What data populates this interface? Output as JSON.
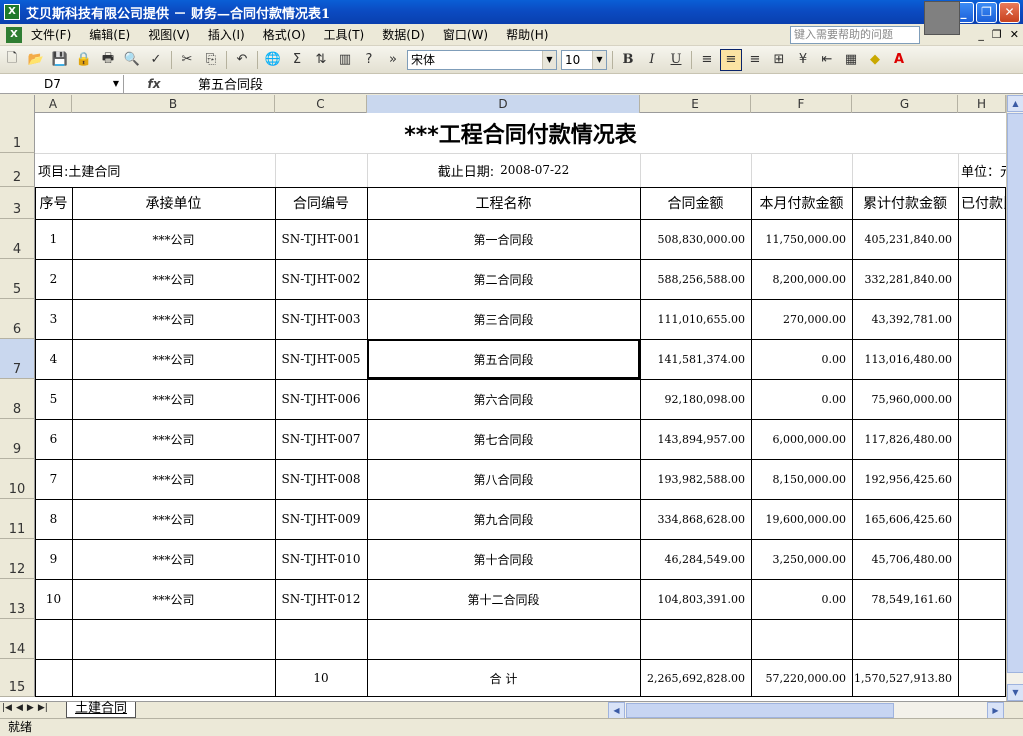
{
  "window": {
    "title": "艾贝斯科技有限公司提供 － 财务—合同付款情况表1"
  },
  "menu": [
    {
      "label": "文件(F)"
    },
    {
      "label": "编辑(E)"
    },
    {
      "label": "视图(V)"
    },
    {
      "label": "插入(I)"
    },
    {
      "label": "格式(O)"
    },
    {
      "label": "工具(T)"
    },
    {
      "label": "数据(D)"
    },
    {
      "label": "窗口(W)"
    },
    {
      "label": "帮助(H)"
    }
  ],
  "help_placeholder": "键入需要帮助的问题",
  "toolbar": {
    "font": "宋体",
    "font_size": "10"
  },
  "formula_bar": {
    "name_box": "D7",
    "value": "第五合同段"
  },
  "columns": [
    "A",
    "B",
    "C",
    "D",
    "E",
    "F",
    "G",
    "H"
  ],
  "rows": [
    "1",
    "2",
    "3",
    "4",
    "5",
    "6",
    "7",
    "8",
    "9",
    "10",
    "11",
    "12",
    "13",
    "14",
    "15"
  ],
  "sheet": {
    "title": "***工程合同付款情况表",
    "project": "项目:土建合同",
    "date_label": "截止日期:",
    "date_value": "2008-07-22",
    "unit": "单位：元",
    "headers": [
      "序号",
      "承接单位",
      "合同编号",
      "工程名称",
      "合同金额",
      "本月付款金额",
      "累计付款金额",
      "已付款比例"
    ],
    "records": [
      {
        "no": "1",
        "company": "***公司",
        "code": "SN-TJHT-001",
        "name": "第一合同段",
        "amount": "508,830,000.00",
        "month": "11,750,000.00",
        "total": "405,231,840.00"
      },
      {
        "no": "2",
        "company": "***公司",
        "code": "SN-TJHT-002",
        "name": "第二合同段",
        "amount": "588,256,588.00",
        "month": "8,200,000.00",
        "total": "332,281,840.00"
      },
      {
        "no": "3",
        "company": "***公司",
        "code": "SN-TJHT-003",
        "name": "第三合同段",
        "amount": "111,010,655.00",
        "month": "270,000.00",
        "total": "43,392,781.00"
      },
      {
        "no": "4",
        "company": "***公司",
        "code": "SN-TJHT-005",
        "name": "第五合同段",
        "amount": "141,581,374.00",
        "month": "0.00",
        "total": "113,016,480.00"
      },
      {
        "no": "5",
        "company": "***公司",
        "code": "SN-TJHT-006",
        "name": "第六合同段",
        "amount": "92,180,098.00",
        "month": "0.00",
        "total": "75,960,000.00"
      },
      {
        "no": "6",
        "company": "***公司",
        "code": "SN-TJHT-007",
        "name": "第七合同段",
        "amount": "143,894,957.00",
        "month": "6,000,000.00",
        "total": "117,826,480.00"
      },
      {
        "no": "7",
        "company": "***公司",
        "code": "SN-TJHT-008",
        "name": "第八合同段",
        "amount": "193,982,588.00",
        "month": "8,150,000.00",
        "total": "192,956,425.60"
      },
      {
        "no": "8",
        "company": "***公司",
        "code": "SN-TJHT-009",
        "name": "第九合同段",
        "amount": "334,868,628.00",
        "month": "19,600,000.00",
        "total": "165,606,425.60"
      },
      {
        "no": "9",
        "company": "***公司",
        "code": "SN-TJHT-010",
        "name": "第十合同段",
        "amount": "46,284,549.00",
        "month": "3,250,000.00",
        "total": "45,706,480.00"
      },
      {
        "no": "10",
        "company": "***公司",
        "code": "SN-TJHT-012",
        "name": "第十二合同段",
        "amount": "104,803,391.00",
        "month": "0.00",
        "total": "78,549,161.60"
      }
    ],
    "totals": {
      "count": "10",
      "label": "合    计",
      "amount": "2,265,692,828.00",
      "month": "57,220,000.00",
      "total": "1,570,527,913.80"
    }
  },
  "tabs": [
    {
      "label": "土建合同"
    }
  ],
  "status": "就绪"
}
